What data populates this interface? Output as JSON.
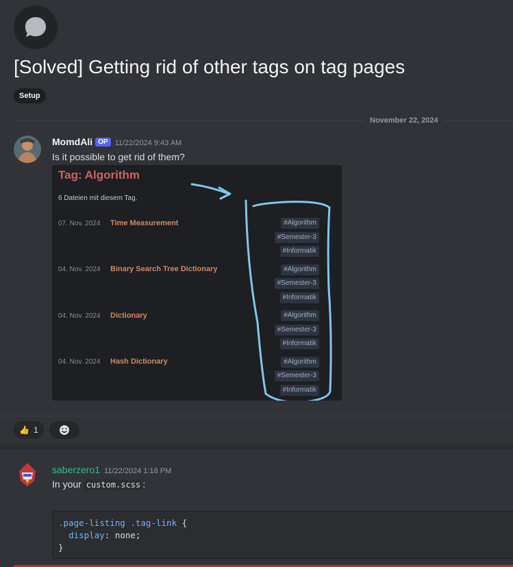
{
  "thread": {
    "title": "[Solved] Getting rid of other tags on tag pages",
    "tag": "Setup"
  },
  "date_divider": "November 22, 2024",
  "message1": {
    "author": "MomdAli",
    "badge": "OP",
    "timestamp": "11/22/2024 9:43 AM",
    "text": "Is it possible to get rid of them?",
    "screenshot": {
      "title": "Tag: Algorithm",
      "count_text": "6 Dateien mit diesem Tag.",
      "rows": [
        {
          "date": "07. Nov. 2024",
          "title": "Time Measurement",
          "tags": [
            "#Algorithm",
            "#Semester-3",
            "#Informatik"
          ]
        },
        {
          "date": "04. Nov. 2024",
          "title": "Binary Search Tree Dictionary",
          "tags": [
            "#Algorithm",
            "#Semester-3",
            "#Informatik"
          ]
        },
        {
          "date": "04. Nov. 2024",
          "title": "Dictionary",
          "tags": [
            "#Algorithm",
            "#Semester-3",
            "#Informatik"
          ]
        },
        {
          "date": "04. Nov. 2024",
          "title": "Hash Dictionary",
          "tags": [
            "#Algorithm",
            "#Semester-3",
            "#Informatik"
          ]
        }
      ]
    },
    "reactions": {
      "thumbs_count": "1",
      "thumbs_emoji": "👍"
    }
  },
  "message2": {
    "author": "saberzero1",
    "timestamp": "11/22/2024 1:18 PM",
    "text_prefix": "In your",
    "code_inline": "custom.scss",
    "text_suffix": ":",
    "code": {
      "line1_selector": ".page-listing .tag-link",
      "line1_brace": " {",
      "line2_prop": "display",
      "line2_value": ": none;",
      "line3": "}"
    }
  },
  "colors": {
    "background": "#323339",
    "accent_op": "#5865f2",
    "author2": "#2ebf8e",
    "annotation": "#7cc8f0"
  }
}
